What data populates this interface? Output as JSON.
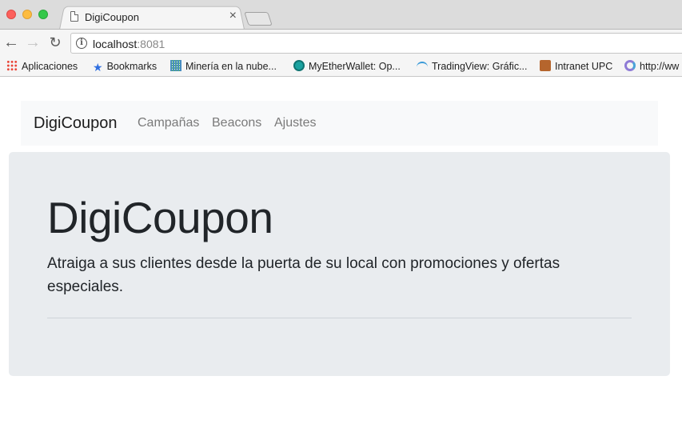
{
  "browser": {
    "tab": {
      "title": "DigiCoupon",
      "close_glyph": "×"
    },
    "toolbar": {
      "back_glyph": "←",
      "forward_glyph": "→",
      "reload_glyph": "↻",
      "info_glyph": "i",
      "url_host": "localhost",
      "url_port": ":8081"
    },
    "bookmarks": [
      {
        "label": "Aplicaciones",
        "icon": "apps-grid-icon"
      },
      {
        "label": "Bookmarks",
        "icon": "star-icon"
      },
      {
        "label": "Minería en la nube...",
        "icon": "site-favicon"
      },
      {
        "label": "MyEtherWallet: Op...",
        "icon": "myetherwallet-icon"
      },
      {
        "label": "TradingView: Gráfic...",
        "icon": "tradingview-icon"
      },
      {
        "label": "Intranet UPC",
        "icon": "upc-favicon"
      },
      {
        "label": "http://ww",
        "icon": "link-favicon"
      }
    ],
    "star_glyph": "★"
  },
  "navbar": {
    "brand": "DigiCoupon",
    "links": [
      "Campañas",
      "Beacons",
      "Ajustes"
    ]
  },
  "jumbotron": {
    "heading": "DigiCoupon",
    "lead": "Atraiga a sus clientes desde la puerta de su local con promociones y ofertas especiales."
  },
  "colors": {
    "jumbotron_bg": "#e9ecef",
    "navbar_bg": "#f8f9fa",
    "link_muted": "#7a7a7a"
  }
}
